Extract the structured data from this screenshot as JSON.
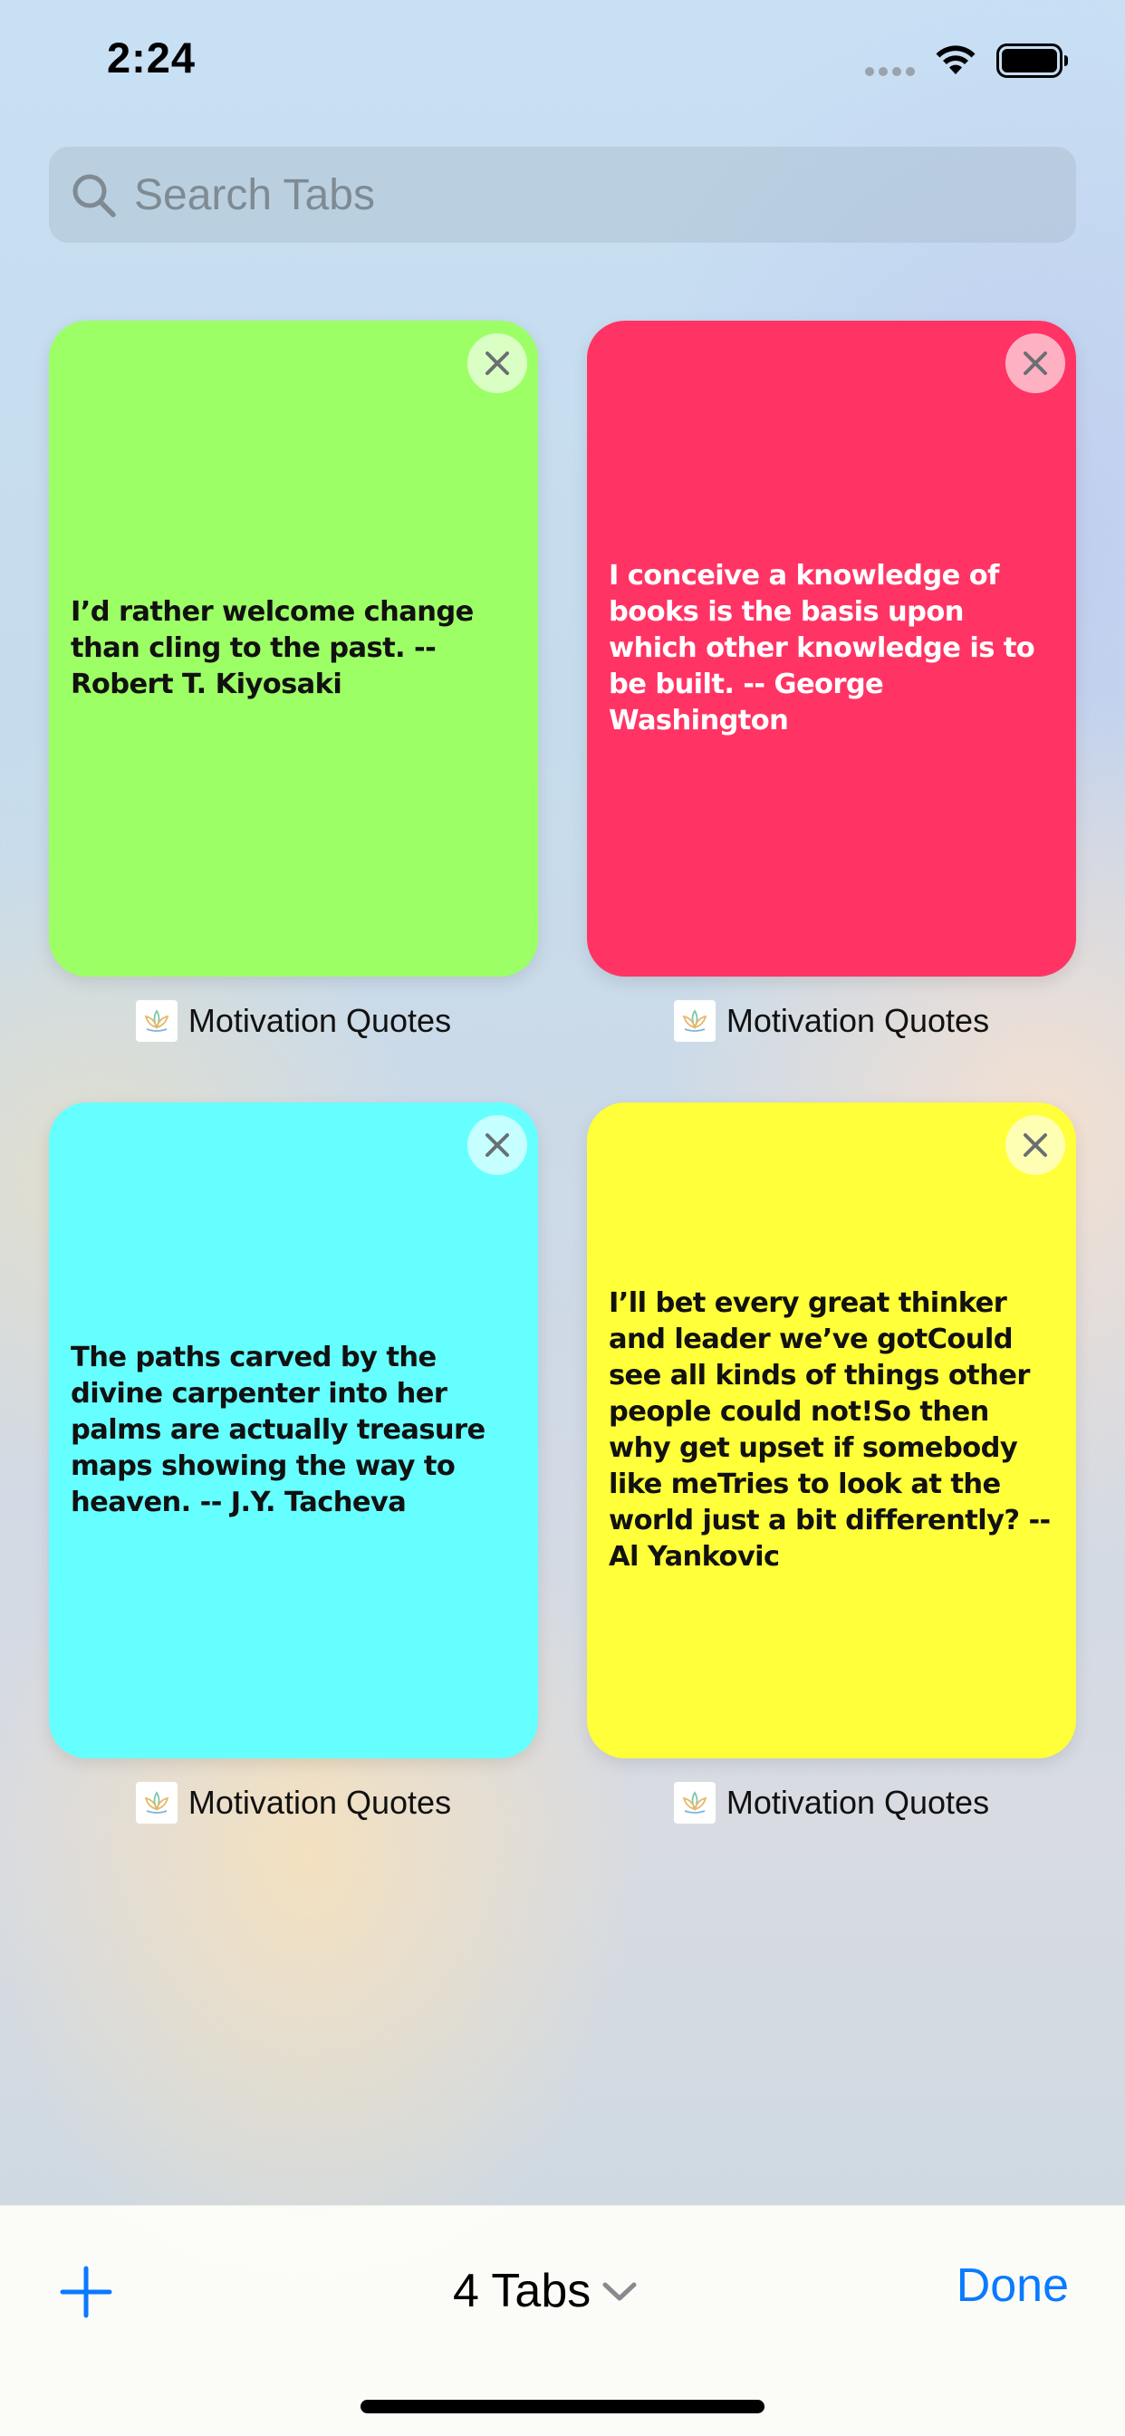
{
  "status_bar": {
    "time": "2:24"
  },
  "search": {
    "placeholder": "Search Tabs",
    "icon": "magnifying-glass"
  },
  "tabs": [
    {
      "quote": "I’d rather welcome change than cling to the past. -- Robert T. Kiyosaki",
      "title": "Motivation Quotes",
      "background": "#9dff66",
      "text_color": "#111111"
    },
    {
      "quote": "I conceive a knowledge of books is the basis upon which other knowledge is to be built. -- George Washington",
      "title": "Motivation Quotes",
      "background": "#ff3464",
      "text_color": "#ffffff"
    },
    {
      "quote": "The paths carved by the divine carpenter into her palms are actually treasure maps showing the way to heaven. -- J.Y. Tacheva",
      "title": "Motivation Quotes",
      "background": "#66ffff",
      "text_color": "#111111"
    },
    {
      "quote": "I’ll bet every great thinker and leader we’ve gotCould see all kinds of things other people could not!So then why get upset if somebody like meTries to look at the world just a bit differently? -- Al Yankovic",
      "title": "Motivation Quotes",
      "background": "#ffff3a",
      "text_color": "#111111"
    }
  ],
  "toolbar": {
    "add_icon": "plus",
    "tab_count_label": "4 Tabs",
    "done_label": "Done",
    "accent_color": "#0a7aff"
  }
}
